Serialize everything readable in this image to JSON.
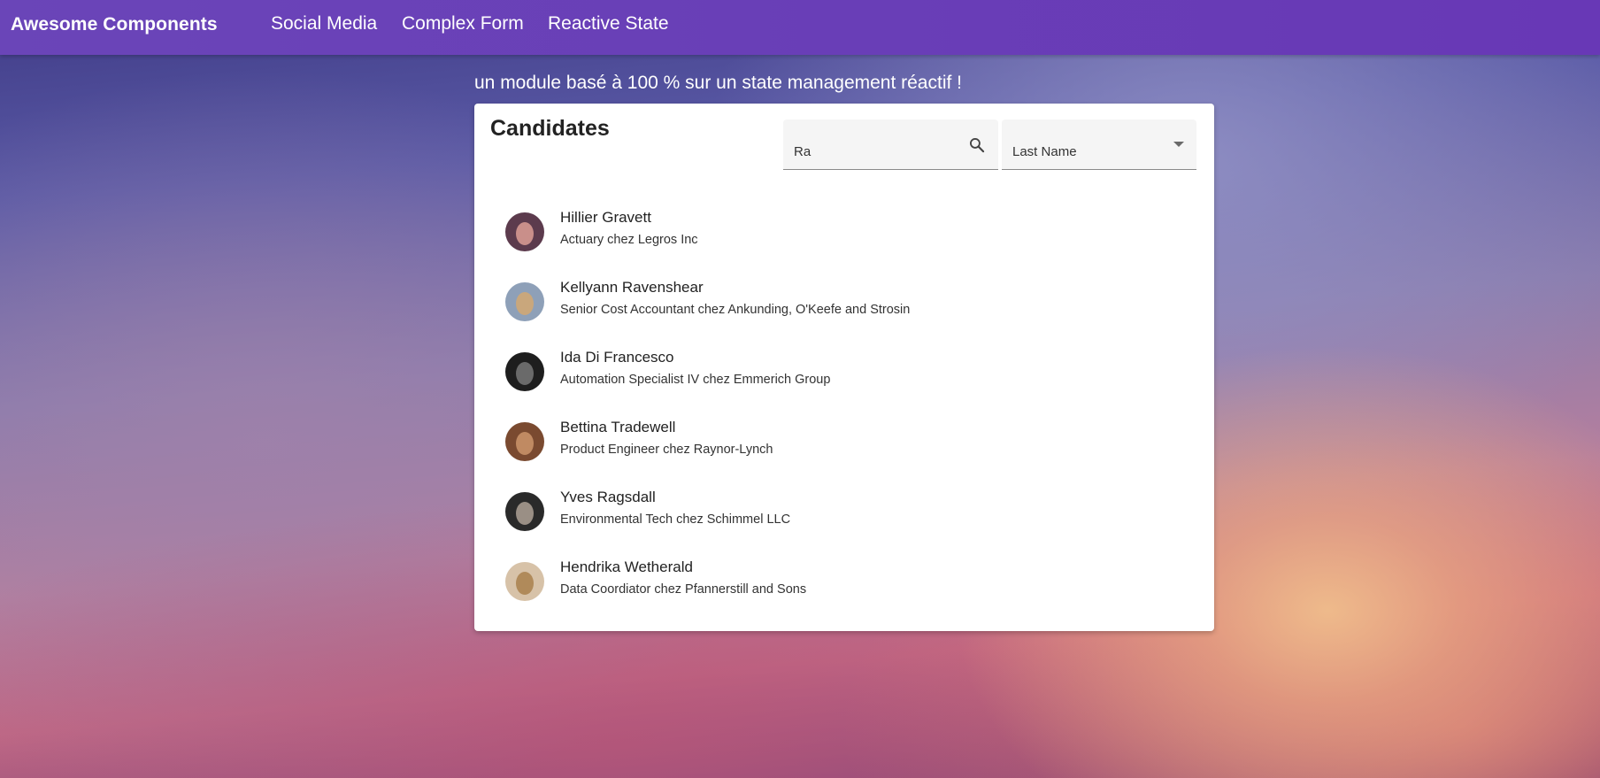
{
  "header": {
    "brand": "Awesome Components",
    "nav": [
      {
        "label": "Social Media"
      },
      {
        "label": "Complex Form"
      },
      {
        "label": "Reactive State"
      }
    ]
  },
  "subtitle": "un module basé à 100 % sur un state management réactif !",
  "card": {
    "title": "Candidates",
    "search": {
      "value": "Ra",
      "icon": "search-icon"
    },
    "sort": {
      "selected": "Last Name",
      "icon": "chevron-down-icon"
    },
    "candidates": [
      {
        "name": "Hillier Gravett",
        "description": "Actuary chez Legros Inc",
        "avatar_colors": [
          "#5c3b4d",
          "#c98f8a"
        ]
      },
      {
        "name": "Kellyann Ravenshear",
        "description": "Senior Cost Accountant chez Ankunding, O'Keefe and Strosin",
        "avatar_colors": [
          "#8ea0b8",
          "#c9a77c"
        ]
      },
      {
        "name": "Ida Di Francesco",
        "description": "Automation Specialist IV chez Emmerich Group",
        "avatar_colors": [
          "#1e1e1e",
          "#6a6a6a"
        ]
      },
      {
        "name": "Bettina Tradewell",
        "description": "Product Engineer chez Raynor-Lynch",
        "avatar_colors": [
          "#7a4a30",
          "#c08a62"
        ]
      },
      {
        "name": "Yves Ragsdall",
        "description": "Environmental Tech chez Schimmel LLC",
        "avatar_colors": [
          "#2a2a2a",
          "#9a8f85"
        ]
      },
      {
        "name": "Hendrika Wetherald",
        "description": "Data Coordiator chez Pfannerstill and Sons",
        "avatar_colors": [
          "#d7c2a8",
          "#b08a5a"
        ]
      }
    ]
  },
  "colors": {
    "toolbar": "#673ab7",
    "card_background": "#ffffff",
    "field_background": "#f5f5f5"
  }
}
